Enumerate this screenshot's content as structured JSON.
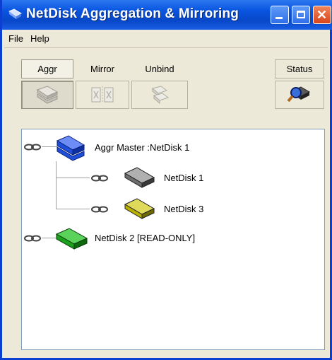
{
  "window": {
    "title": "NetDisk Aggregation & Mirroring",
    "colors": {
      "titlebar": "#0a55e0",
      "close": "#d9451c",
      "face": "#ece9d8"
    }
  },
  "menu": {
    "items": [
      "File",
      "Help"
    ]
  },
  "toolbar": {
    "aggr_label": "Aggr",
    "mirror_label": "Mirror",
    "unbind_label": "Unbind",
    "status_label": "Status"
  },
  "tree": {
    "aggr_master": "Aggr Master :NetDisk 1",
    "child_1": "NetDisk 1",
    "child_2": "NetDisk 3",
    "standalone": "NetDisk 2  [READ-ONLY]",
    "colors": {
      "master": "#1e4fd8",
      "child_1": "#6e6e6e",
      "child_2": "#b8b000",
      "standalone": "#1aa01a"
    }
  }
}
